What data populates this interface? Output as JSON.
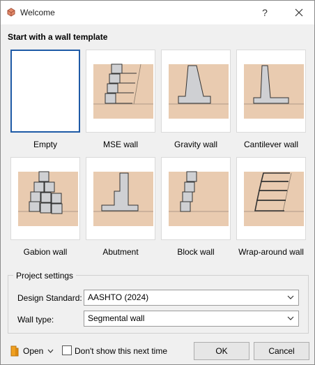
{
  "window": {
    "title": "Welcome",
    "help_label": "?",
    "icons": {
      "app": "app-logo-icon",
      "close": "close-icon"
    }
  },
  "templates": {
    "heading": "Start with a wall template",
    "items": [
      {
        "label": "Empty",
        "selected": true
      },
      {
        "label": "MSE wall",
        "selected": false
      },
      {
        "label": "Gravity wall",
        "selected": false
      },
      {
        "label": "Cantilever wall",
        "selected": false
      },
      {
        "label": "Gabion wall",
        "selected": false
      },
      {
        "label": "Abutment",
        "selected": false
      },
      {
        "label": "Block wall",
        "selected": false
      },
      {
        "label": "Wrap-around wall",
        "selected": false
      }
    ]
  },
  "project_settings": {
    "title": "Project settings",
    "design_standard": {
      "label": "Design Standard:",
      "value": "AASHTO (2024)"
    },
    "wall_type": {
      "label": "Wall type:",
      "value": "Segmental wall"
    }
  },
  "footer": {
    "open_label": "Open",
    "dont_show_label": "Don't show this next time",
    "dont_show_checked": false,
    "ok_label": "OK",
    "cancel_label": "Cancel"
  },
  "colors": {
    "soil": "#e9cbb0",
    "concrete": "#cfd0d3",
    "selection": "#1e5aa6",
    "accent_orange": "#f0a020"
  }
}
